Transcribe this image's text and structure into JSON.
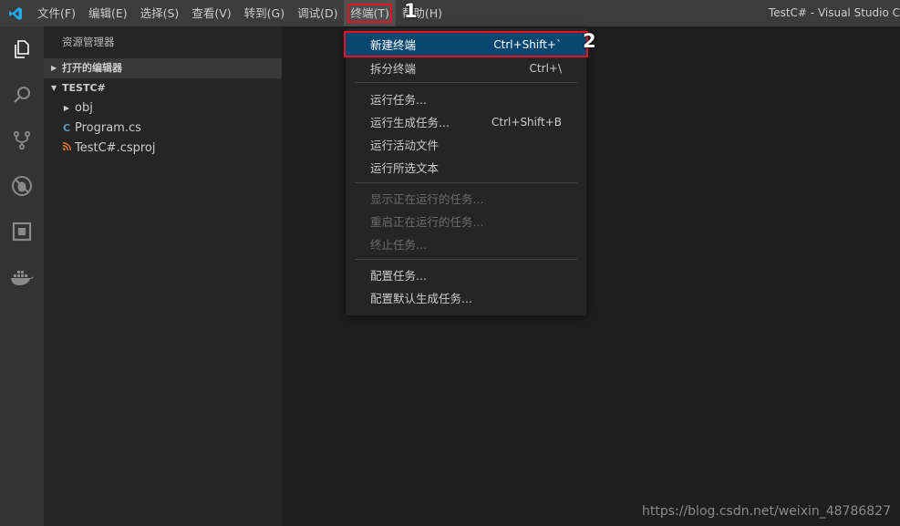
{
  "menubar": {
    "items": [
      "文件(F)",
      "编辑(E)",
      "选择(S)",
      "查看(V)",
      "转到(G)",
      "调试(D)",
      "终端(T)",
      "帮助(H)"
    ],
    "window_title": "TestC# - Visual Studio C"
  },
  "activity_bar": {
    "icons": [
      "explorer-icon",
      "search-icon",
      "source-control-icon",
      "debug-icon",
      "extensions-icon",
      "docker-icon"
    ]
  },
  "sidebar": {
    "title": "资源管理器",
    "open_editors_label": "打开的编辑器",
    "project_label": "TESTC#",
    "tree": [
      {
        "label": "obj",
        "icon": "folder-chevron-icon"
      },
      {
        "label": "Program.cs",
        "icon": "csharp-file-icon"
      },
      {
        "label": "TestC#.csproj",
        "icon": "rss-file-icon"
      }
    ]
  },
  "terminal_menu": {
    "groups": [
      [
        {
          "label": "新建终端",
          "shortcut": "Ctrl+Shift+`",
          "enabled": true,
          "highlighted": true
        },
        {
          "label": "拆分终端",
          "shortcut": "Ctrl+\\",
          "enabled": true
        }
      ],
      [
        {
          "label": "运行任务...",
          "shortcut": "",
          "enabled": true
        },
        {
          "label": "运行生成任务...",
          "shortcut": "Ctrl+Shift+B",
          "enabled": true
        },
        {
          "label": "运行活动文件",
          "shortcut": "",
          "enabled": true
        },
        {
          "label": "运行所选文本",
          "shortcut": "",
          "enabled": true
        }
      ],
      [
        {
          "label": "显示正在运行的任务...",
          "shortcut": "",
          "enabled": false
        },
        {
          "label": "重启正在运行的任务...",
          "shortcut": "",
          "enabled": false
        },
        {
          "label": "终止任务...",
          "shortcut": "",
          "enabled": false
        }
      ],
      [
        {
          "label": "配置任务...",
          "shortcut": "",
          "enabled": true
        },
        {
          "label": "配置默认生成任务...",
          "shortcut": "",
          "enabled": true
        }
      ]
    ]
  },
  "annotations": {
    "step1": "1",
    "step2": "2"
  },
  "watermark": "https://blog.csdn.net/weixin_48786827",
  "colors": {
    "accent": "#007acc",
    "highlight": "#094771",
    "annotation_red": "#e81123"
  }
}
